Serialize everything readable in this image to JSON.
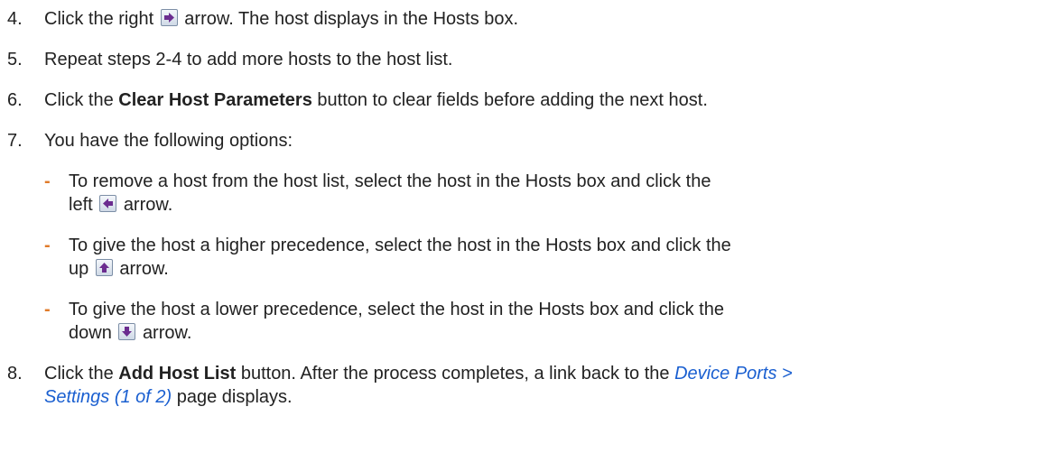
{
  "steps": [
    {
      "number": "4.",
      "a": "Click the right",
      "b": "arrow. The host displays in the Hosts box."
    },
    {
      "number": "5.",
      "a": "Repeat steps 2-4 to add more hosts to the host list."
    },
    {
      "number": "6.",
      "a": "Click the",
      "bold": "Clear Host Parameters",
      "b": "button to clear fields before adding the next host."
    },
    {
      "number": "7.",
      "a": "You have the following options:"
    },
    {
      "number": "8.",
      "a": "Click the",
      "bold": "Add Host List",
      "b": "button. After the process completes, a link back to the",
      "link1": "Device Ports >",
      "link2": "Settings (1 of 2)",
      "c": "page displays."
    }
  ],
  "options": [
    {
      "dash": "-",
      "line1": "To remove a host from the host list, select the host in the Hosts box and click the",
      "a": "left",
      "b": "arrow.",
      "icon": "left-arrow-icon"
    },
    {
      "dash": "-",
      "line1": "To give the host a higher precedence, select the host in the Hosts box and click the",
      "a": "up",
      "b": "arrow.",
      "icon": "up-arrow-icon"
    },
    {
      "dash": "-",
      "line1": "To give the host a lower precedence, select the host in the Hosts box and click the",
      "a": "down",
      "b": "arrow.",
      "icon": "down-arrow-icon"
    }
  ],
  "colors": {
    "text": "#222222",
    "dash": "#e07b2a",
    "link": "#1a5fd0",
    "arrow": "#6b2c8f"
  }
}
